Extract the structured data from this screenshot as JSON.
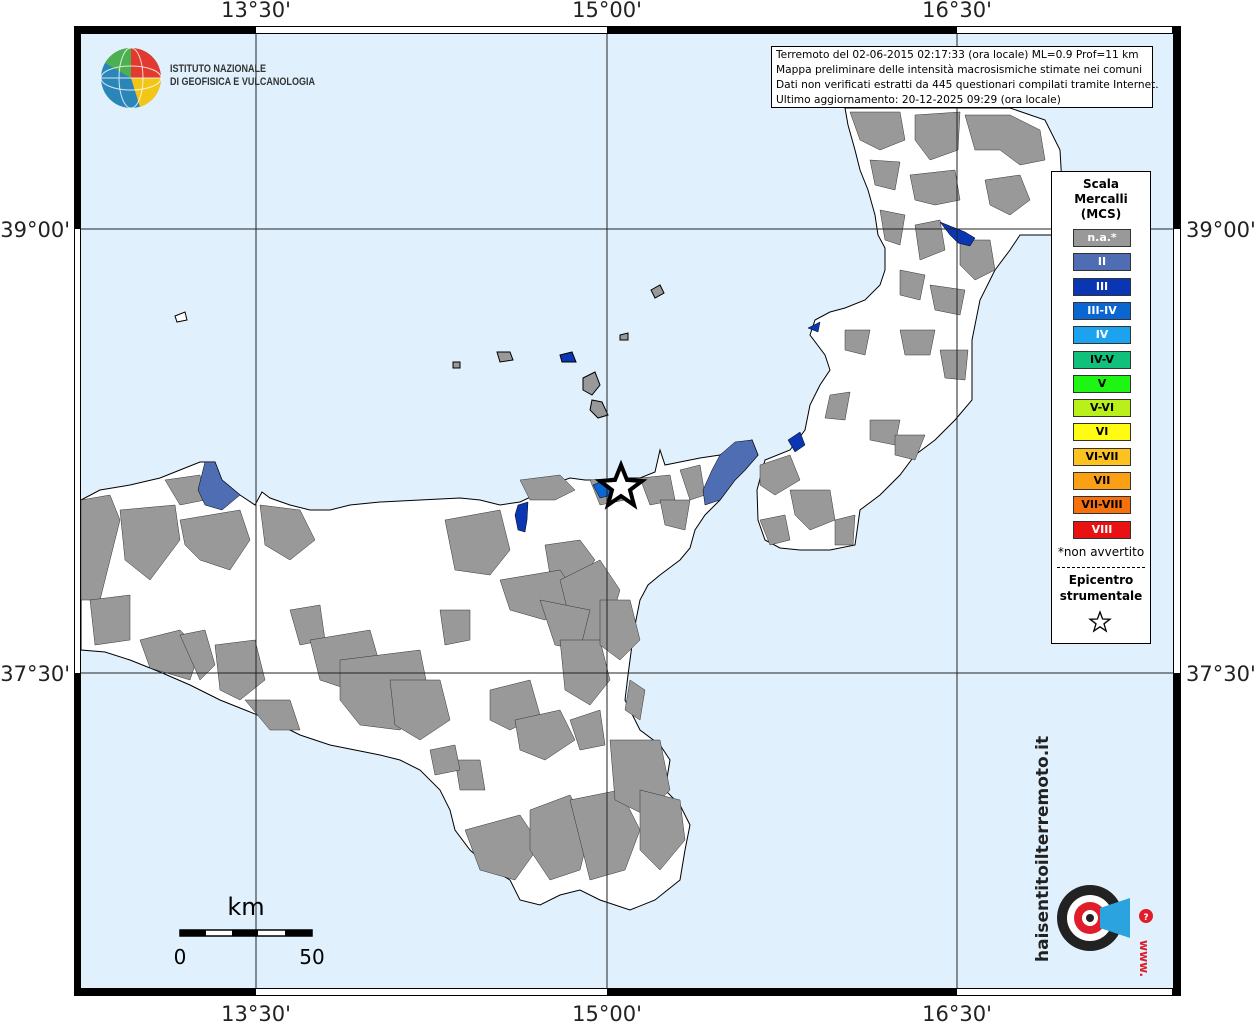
{
  "map": {
    "colors": {
      "sea": "#e0f1fd",
      "land": "#ffffff",
      "not_felt": "#999999",
      "border": "#000000"
    },
    "lat_labels": {
      "north": "39°00'",
      "south": "37°30'"
    },
    "lon_labels": {
      "west": "13°30'",
      "center": "15°00'",
      "east": "16°30'"
    }
  },
  "info": {
    "line1": "Terremoto del 02-06-2015 02:17:33 (ora locale) ML=0.9 Prof=11 km",
    "line2": "Mappa preliminare delle intensità macrosismiche stimate nei comuni",
    "line3": "Dati non verificati estratti da 445 questionari compilati tramite Internet.",
    "line4": "Ultimo aggiornamento: 20-12-2025 09:29 (ora locale)"
  },
  "logo": {
    "ingv_line1": "ISTITUTO NAZIONALE",
    "ingv_line2": "DI GEOFISICA E VULCANOLOGIA",
    "hst_text": "haisentitoilterremoto.it",
    "hst_url": "www."
  },
  "legend": {
    "title": "Scala\nMercalli\n(MCS)",
    "classes": [
      {
        "label": "n.a.*",
        "color": "#999999",
        "text_color": "#ffffff"
      },
      {
        "label": "II",
        "color": "#4e6db3",
        "text_color": "#ffffff"
      },
      {
        "label": "III",
        "color": "#0a36b3",
        "text_color": "#ffffff"
      },
      {
        "label": "III-IV",
        "color": "#0a66d1",
        "text_color": "#ffffff"
      },
      {
        "label": "IV",
        "color": "#1ba3ef",
        "text_color": "#ffffff"
      },
      {
        "label": "IV-V",
        "color": "#11c07a",
        "text_color": "#000000"
      },
      {
        "label": "V",
        "color": "#1ef512",
        "text_color": "#000000"
      },
      {
        "label": "V-VI",
        "color": "#b9f01a",
        "text_color": "#000000"
      },
      {
        "label": "VI",
        "color": "#fffb12",
        "text_color": "#000000"
      },
      {
        "label": "VI-VII",
        "color": "#fbc220",
        "text_color": "#000000"
      },
      {
        "label": "VII",
        "color": "#fba015",
        "text_color": "#000000"
      },
      {
        "label": "VII-VIII",
        "color": "#f6700e",
        "text_color": "#000000"
      },
      {
        "label": "VIII",
        "color": "#e81212",
        "text_color": "#ffffff"
      }
    ],
    "note": "*non avvertito",
    "epicenter_label": "Epicentro\nstrumentale"
  },
  "scale": {
    "unit": "km",
    "min": "0",
    "max": "50"
  }
}
